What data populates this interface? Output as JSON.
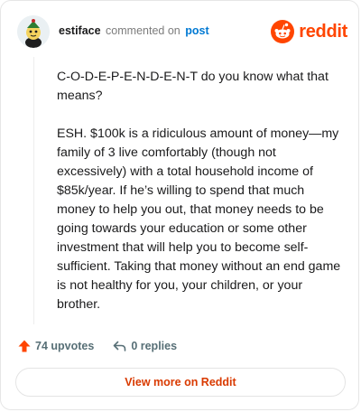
{
  "header": {
    "username": "estiface",
    "action_text": "commented on",
    "post_link": "post",
    "brand_name": "reddit"
  },
  "comment": {
    "paragraphs": [
      "C-O-D-E-P-E-N-D-E-N-T do you know what that means?",
      "ESH. $100k is a ridiculous amount of money—my family of 3 live comfortably (though not excessively) with a total household income of $85k/year. If he’s willing to spend that much money to help you out, that money needs to be going towards your education or some other investment that will help you to become self-sufficient. Taking that money without an end game is not healthy for you, your children, or your brother."
    ]
  },
  "footer": {
    "upvotes_label": "74 upvotes",
    "replies_label": "0 replies"
  },
  "view_button_label": "View more on Reddit",
  "colors": {
    "brand": "#ff4500",
    "link": "#0079d3",
    "muted": "#576f76",
    "button_text": "#d93a00"
  },
  "icons": [
    "avatar",
    "reddit-logo-icon",
    "upvote-arrow-icon",
    "reply-icon"
  ]
}
